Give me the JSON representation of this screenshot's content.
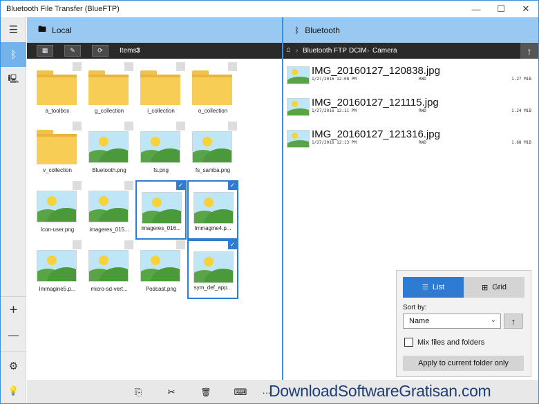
{
  "window": {
    "title": "Bluetooth File Transfer (BlueFTP)",
    "minimize": "—",
    "maximize": "☐",
    "close": "✕"
  },
  "sidebar": {
    "menu_icon": "☰",
    "bluetooth_icon": "ᛒ",
    "devices_icon": "🖳",
    "add_icon": "+",
    "remove_icon": "—",
    "settings_icon": "⚙",
    "tips_icon": "💡"
  },
  "local": {
    "header_icon": "🖿",
    "title": "Local",
    "items_label": "Items:",
    "items_count": "3",
    "tiles": [
      {
        "name": "a_toolbox",
        "type": "folder",
        "selected": false
      },
      {
        "name": "g_collection",
        "type": "folder",
        "selected": false
      },
      {
        "name": "i_collection",
        "type": "folder",
        "selected": false
      },
      {
        "name": "o_collection",
        "type": "folder",
        "selected": false
      },
      {
        "name": "v_collection",
        "type": "folder",
        "selected": false
      },
      {
        "name": "Bluetooth.png",
        "type": "image",
        "selected": false
      },
      {
        "name": "fs.png",
        "type": "image",
        "selected": false
      },
      {
        "name": "fs_samba.png",
        "type": "image",
        "selected": false
      },
      {
        "name": "Icon-user.png",
        "type": "image",
        "selected": false
      },
      {
        "name": "imageres_015...",
        "type": "image",
        "selected": false
      },
      {
        "name": "imageres_016...",
        "type": "image",
        "selected": true
      },
      {
        "name": "Immagine4.p...",
        "type": "image",
        "selected": true
      },
      {
        "name": "Immagine5.p...",
        "type": "image",
        "selected": false
      },
      {
        "name": "micro-sd-vert...",
        "type": "image",
        "selected": false
      },
      {
        "name": "Podcast.png",
        "type": "image",
        "selected": false
      },
      {
        "name": "sym_def_app...",
        "type": "image",
        "selected": true
      }
    ]
  },
  "remote": {
    "header_icon": "ᛒ",
    "title": "Bluetooth",
    "breadcrumb": {
      "home_icon": "⌂",
      "parts": [
        "Bluetooth FTP",
        "DCIM",
        "Camera"
      ],
      "sep": "›"
    },
    "up_icon": "↑",
    "files": [
      {
        "name": "IMG_20160127_120838.jpg",
        "date": "1/27/2016 12:08 PM",
        "attr": "RWD",
        "size": "1.27 MiB"
      },
      {
        "name": "IMG_20160127_121115.jpg",
        "date": "1/27/2016 12:11 PM",
        "attr": "RWD",
        "size": "1.24 MiB"
      },
      {
        "name": "IMG_20160127_121316.jpg",
        "date": "1/27/2016 12:13 PM",
        "attr": "RWD",
        "size": "1.68 MiB"
      }
    ]
  },
  "view_popup": {
    "list_label": "List",
    "grid_label": "Grid",
    "sort_by_label": "Sort by:",
    "sort_value": "Name",
    "sort_dir_icon": "↑",
    "mix_label": "Mix files and folders",
    "mix_checked": false,
    "apply_label": "Apply to current folder only"
  },
  "bottombar": {
    "copy_icon": "⎘",
    "cut_icon": "✂",
    "delete_icon": "🗑",
    "rename_icon": "⌨",
    "more_icon": "···"
  },
  "watermark": "DownloadSoftwareGratisan.com",
  "colors": {
    "accent": "#2d7bd3",
    "header": "#99c8f0",
    "folder": "#f7cd55",
    "toolbar": "#2a2a2a"
  }
}
